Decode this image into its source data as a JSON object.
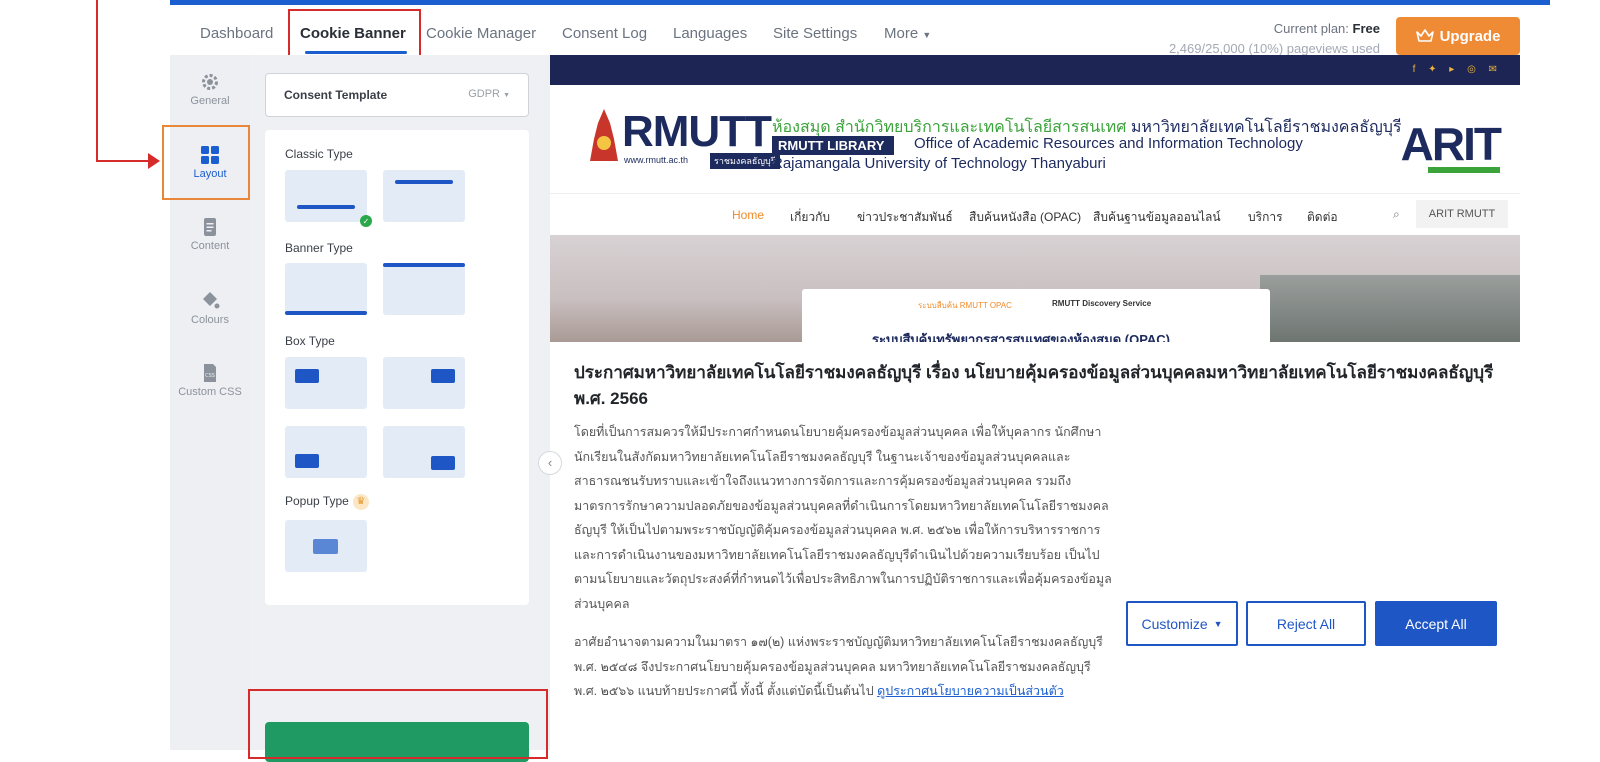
{
  "nav": {
    "items": [
      "Dashboard",
      "Cookie Banner",
      "Cookie Manager",
      "Consent Log",
      "Languages",
      "Site Settings",
      "More"
    ],
    "active": "Cookie Banner"
  },
  "plan": {
    "label": "Current plan:",
    "name": "Free",
    "usage": "2,469/25,000 (10%) pageviews used",
    "upgrade_label": "Upgrade"
  },
  "rail": {
    "items": [
      {
        "label": "General",
        "icon": "gear-icon"
      },
      {
        "label": "Layout",
        "icon": "grid-icon"
      },
      {
        "label": "Content",
        "icon": "document-icon"
      },
      {
        "label": "Colours",
        "icon": "paint-bucket-icon"
      },
      {
        "label": "Custom CSS",
        "icon": "css-file-icon"
      }
    ],
    "active": "Layout"
  },
  "panel": {
    "template_label": "Consent Template",
    "template_value": "GDPR",
    "sections": {
      "classic": "Classic Type",
      "banner": "Banner Type",
      "box": "Box Type",
      "popup": "Popup Type"
    }
  },
  "preview": {
    "site": {
      "logo": "RMUTT",
      "logo_url": "www.rmutt.ac.th",
      "logo_tag": "ราชมงคลธัญบุรี",
      "thai_title_green": "ห้องสมุด สำนักวิทยบริการและเทคโนโลยีสารสนเทศ",
      "thai_title_dark": "มหาวิทยาลัยเทคโนโลยีราชมงคลธัญบุรี",
      "library_pill": "RMUTT LIBRARY",
      "office_en": "Office of Academic Resources and Information Technology",
      "university_en": "Rajamangala University of Technology Thanyaburi",
      "arit": "ARIT",
      "menu": [
        "Home",
        "เกี่ยวกับ",
        "ข่าวประชาสัมพันธ์",
        "สืบค้นหนังสือ (OPAC)",
        "สืบค้นฐานข้อมูลออนไลน์",
        "บริการ",
        "ติดต่อ"
      ],
      "menu_search_button": "ARIT RMUTT",
      "hero_tab_1": "ระบบสืบค้น RMUTT OPAC",
      "hero_tab_2": "RMUTT Discovery Service",
      "hero_heading": "ระบบสืบค้นทรัพยากรสารสนเทศของห้องสมุด (OPAC)"
    },
    "banner": {
      "title": "ประกาศมหาวิทยาลัยเทคโนโลยีราชมงคลธัญบุรี เรื่อง นโยบายคุ้มครองข้อมูลส่วนบุคคลมหาวิทยาลัยเทคโนโลยีราชมงคลธัญบุรี พ.ศ. 2566",
      "body_1": "โดยที่เป็นการสมควรให้มีประกาศกำหนดนโยบายคุ้มครองข้อมูลส่วนบุคคล เพื่อให้บุคลากร นักศึกษา นักเรียนในสังกัดมหาวิทยาลัยเทคโนโลยีราชมงคลธัญบุรี ในฐานะเจ้าของข้อมูลส่วนบุคคลและสาธารณชนรับทราบและเข้าใจถึงแนวทางการจัดการและการคุ้มครองข้อมูลส่วนบุคคล รวมถึงมาตรการรักษาความปลอดภัยของข้อมูลส่วนบุคคลที่ดำเนินการโดยมหาวิทยาลัยเทคโนโลยีราชมงคลธัญบุรี ให้เป็นไปตามพระราชบัญญัติคุ้มครองข้อมูลส่วนบุคคล พ.ศ. ๒๕๖๒ เพื่อให้การบริหารราชการและการดำเนินงานของมหาวิทยาลัยเทคโนโลยีราชมงคลธัญบุรีดำเนินไปด้วยความเรียบร้อย เป็นไปตามนโยบายและวัตถุประสงค์ที่กำหนดไว้เพื่อประสิทธิภาพในการปฏิบัติราชการและเพื่อคุ้มครองข้อมูลส่วนบุคคล",
      "body_2": "อาศัยอำนาจตามความในมาตรา ๑๗(๒) แห่งพระราชบัญญัติมหาวิทยาลัยเทคโนโลยีราชมงคลธัญบุรี พ.ศ. ๒๕๔๘ จึงประกาศนโยบายคุ้มครองข้อมูลส่วนบุคคล มหาวิทยาลัยเทคโนโลยีราชมงคลธัญบุรี พ.ศ. ๒๕๖๖ แนบท้ายประกาศนี้ ทั้งนี้ ตั้งแต่บัดนี้เป็นต้นไป",
      "link": "ดูประกาศนโยบายความเป็นส่วนตัว",
      "customize_label": "Customize",
      "reject_label": "Reject All",
      "accept_label": "Accept All"
    }
  },
  "colors": {
    "primary": "#1f56c5",
    "upgrade": "#ef8a35",
    "annotation": "#d62b2b",
    "save": "#1e9a62"
  }
}
